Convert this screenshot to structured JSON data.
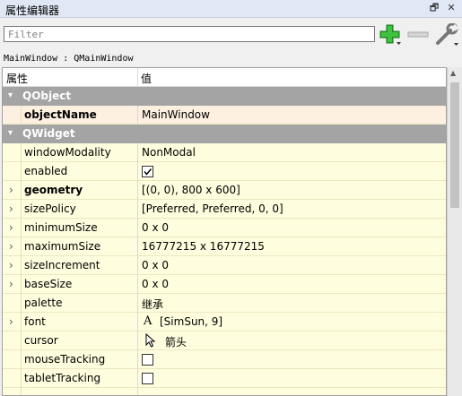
{
  "window": {
    "title": "属性编辑器"
  },
  "titlebar": {
    "float_glyph": "🗗",
    "close_glyph": "✕"
  },
  "filter": {
    "placeholder": "Filter",
    "value": ""
  },
  "toolbar": {
    "add_icon": "plus-icon",
    "remove_icon": "minus-icon",
    "config_icon": "wrench-icon"
  },
  "object_label": "MainWindow : QMainWindow",
  "tree": {
    "headers": {
      "property": "属性",
      "value": "值"
    },
    "groups": [
      {
        "name": "QObject"
      },
      {
        "name": "QWidget"
      }
    ],
    "rows": [
      {
        "name": "objectName",
        "value": "MainWindow",
        "bold": true,
        "selected": true
      },
      {
        "name": "windowModality",
        "value": "NonModal"
      },
      {
        "name": "enabled",
        "checked": true
      },
      {
        "name": "geometry",
        "value": "[(0, 0), 800 x 600]",
        "bold": true,
        "expandable": true
      },
      {
        "name": "sizePolicy",
        "value": "[Preferred, Preferred, 0, 0]",
        "expandable": true
      },
      {
        "name": "minimumSize",
        "value": "0 x 0",
        "expandable": true
      },
      {
        "name": "maximumSize",
        "value": "16777215 x 16777215",
        "expandable": true
      },
      {
        "name": "sizeIncrement",
        "value": "0 x 0",
        "expandable": true
      },
      {
        "name": "baseSize",
        "value": "0 x 0",
        "expandable": true
      },
      {
        "name": "palette",
        "value": "继承"
      },
      {
        "name": "font",
        "value": "[SimSun, 9]",
        "icon": "A",
        "expandable": true
      },
      {
        "name": "cursor",
        "value": "箭头",
        "icon": "arrow-cursor-icon"
      },
      {
        "name": "mouseTracking",
        "checked": false
      },
      {
        "name": "tabletTracking",
        "checked": false
      }
    ]
  },
  "colors": {
    "group_bg": "#a4a4a4",
    "row_bg": "#fefdde",
    "selected_row_bg": "#fef0e0",
    "add_green": "#2aa62a"
  }
}
